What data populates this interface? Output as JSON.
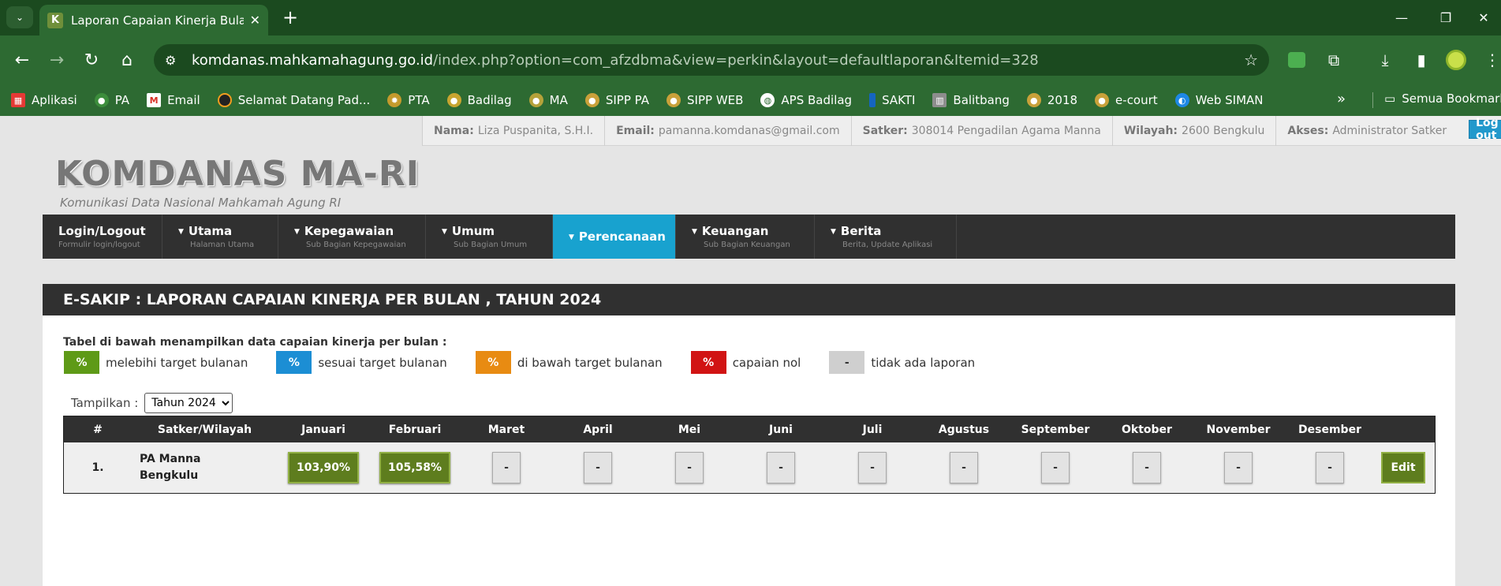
{
  "browser": {
    "tab_title": "Laporan Capaian Kinerja Bulanan",
    "tab_favicon_letter": "K",
    "url_host": "komdanas.mahkamahagung.go.id",
    "url_path": "/index.php?option=com_afzdbma&view=perkin&layout=defaultlaporan&Itemid=328",
    "bookmarks": [
      {
        "label": "Aplikasi",
        "icon": "apps-grid-icon"
      },
      {
        "label": "PA",
        "icon": "pa-icon"
      },
      {
        "label": "Email",
        "icon": "gmail-icon"
      },
      {
        "label": "Selamat Datang Pad...",
        "icon": "site-icon"
      },
      {
        "label": "PTA",
        "icon": "pta-icon"
      },
      {
        "label": "Badilag",
        "icon": "badilag-icon"
      },
      {
        "label": "MA",
        "icon": "ma-icon"
      },
      {
        "label": "SIPP PA",
        "icon": "sipp-icon"
      },
      {
        "label": "SIPP WEB",
        "icon": "sipp-icon"
      },
      {
        "label": "APS Badilag",
        "icon": "globe-icon"
      },
      {
        "label": "SAKTI",
        "icon": "sakti-icon"
      },
      {
        "label": "Balitbang",
        "icon": "balitbang-icon"
      },
      {
        "label": "2018",
        "icon": "emblem-icon"
      },
      {
        "label": "e-court",
        "icon": "emblem-icon"
      },
      {
        "label": "Web SIMAN",
        "icon": "siman-icon"
      }
    ],
    "all_bookmarks": "Semua Bookmark"
  },
  "userbar": {
    "nama_label": "Nama:",
    "nama": "Liza Puspanita, S.H.I.",
    "email_label": "Email:",
    "email": "pamanna.komdanas@gmail.com",
    "satker_label": "Satker:",
    "satker": "308014 Pengadilan Agama Manna",
    "wilayah_label": "Wilayah:",
    "wilayah": "2600 Bengkulu",
    "akses_label": "Akses:",
    "akses": "Administrator Satker",
    "logout": "Log out"
  },
  "logo": {
    "title": "KOMDANAS MA-RI",
    "subtitle": "Komunikasi Data Nasional Mahkamah Agung RI"
  },
  "nav": [
    {
      "label": "Login/Logout",
      "sub": "Formulir login/logout",
      "caret": false
    },
    {
      "label": "Utama",
      "sub": "Halaman Utama",
      "caret": true
    },
    {
      "label": "Kepegawaian",
      "sub": "Sub Bagian Kepegawaian",
      "caret": true
    },
    {
      "label": "Umum",
      "sub": "Sub Bagian Umum",
      "caret": true
    },
    {
      "label": "Perencanaan",
      "sub": "",
      "caret": true
    },
    {
      "label": "Keuangan",
      "sub": "Sub Bagian Keuangan",
      "caret": true
    },
    {
      "label": "Berita",
      "sub": "Berita, Update Aplikasi",
      "caret": true
    }
  ],
  "panel": {
    "title": "E-SAKIP : LAPORAN CAPAIAN KINERJA PER BULAN , TAHUN 2024",
    "intro": "Tabel di bawah menampilkan data capaian kinerja per bulan :",
    "legend": [
      {
        "symbol": "%",
        "label": "melebihi target bulanan",
        "color": "#5e9a17"
      },
      {
        "symbol": "%",
        "label": "sesuai target bulanan",
        "color": "#1c8ed4"
      },
      {
        "symbol": "%",
        "label": "di bawah target bulanan",
        "color": "#e88b12"
      },
      {
        "symbol": "%",
        "label": "capaian nol",
        "color": "#d11313"
      },
      {
        "symbol": "-",
        "label": "tidak ada laporan",
        "color": "#cfcfcf"
      }
    ],
    "show_label": "Tampilkan :",
    "show_selected": "Tahun 2024"
  },
  "table": {
    "headers": [
      "#",
      "Satker/Wilayah",
      "Januari",
      "Februari",
      "Maret",
      "April",
      "Mei",
      "Juni",
      "Juli",
      "Agustus",
      "September",
      "Oktober",
      "November",
      "Desember"
    ],
    "rows": [
      {
        "no": "1.",
        "satker_line1": "PA Manna",
        "satker_line2": "Bengkulu",
        "months": [
          "103,90%",
          "105,58%",
          "-",
          "-",
          "-",
          "-",
          "-",
          "-",
          "-",
          "-",
          "-",
          "-"
        ],
        "edit": "Edit"
      }
    ]
  }
}
